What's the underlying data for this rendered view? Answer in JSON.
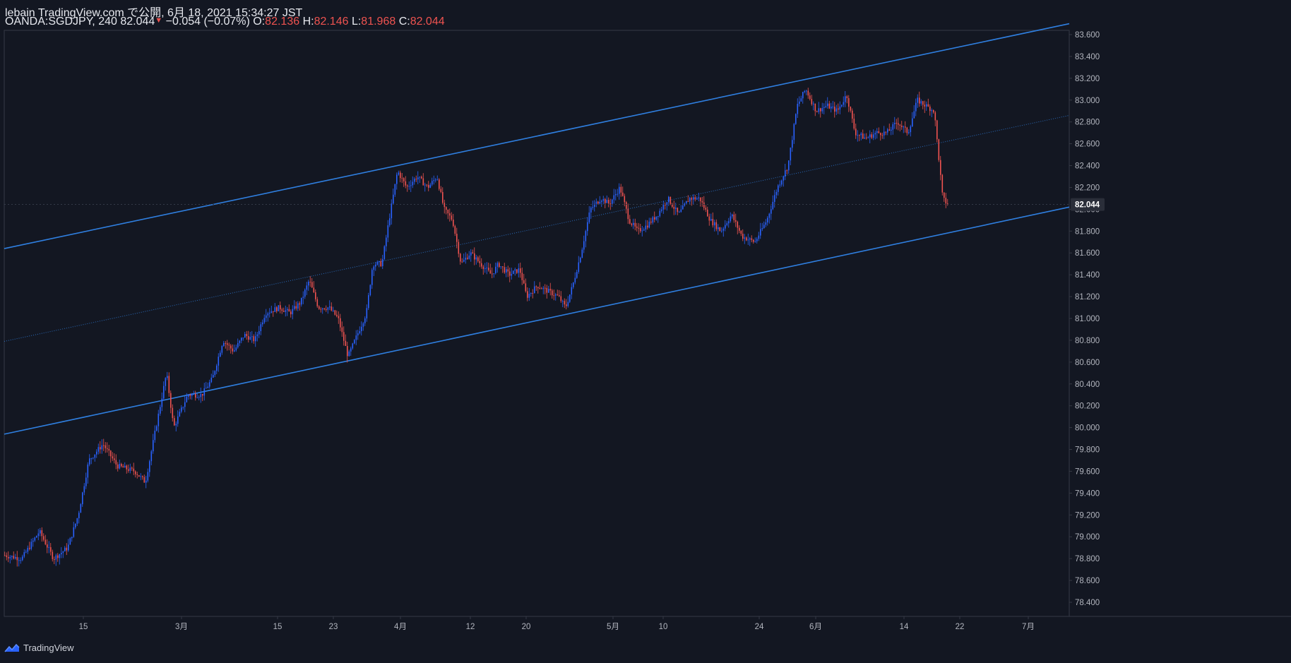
{
  "header": {
    "published_line": "lebain TradingView.com で公開, 6月 18, 2021 15:34:27 JST",
    "symbol": "OANDA:SGDJPY, 240",
    "last": "82.044",
    "change": "−0.054 (−0.07%)",
    "o_label": "O:",
    "o_value": "82.136",
    "h_label": "H:",
    "h_value": "82.146",
    "l_label": "L:",
    "l_value": "81.968",
    "c_label": "C:",
    "c_value": "82.044"
  },
  "footer": {
    "brand": "TradingView"
  },
  "colors": {
    "background": "#131722",
    "up": "#2962ff",
    "down": "#ef5350",
    "channel": "#2f7fe0",
    "axis_text": "#b2b5be",
    "frame": "#363a45"
  },
  "chart_data": {
    "type": "candlestick",
    "symbol": "OANDA:SGDJPY",
    "interval": "240",
    "ylim": [
      78.25,
      83.75
    ],
    "y_ticks": [
      "78.400",
      "78.600",
      "78.800",
      "79.000",
      "79.200",
      "79.400",
      "79.600",
      "79.800",
      "80.000",
      "80.200",
      "80.400",
      "80.600",
      "80.800",
      "81.000",
      "81.200",
      "81.400",
      "81.600",
      "81.800",
      "82.000",
      "82.200",
      "82.400",
      "82.600",
      "82.800",
      "83.000",
      "83.200",
      "83.400",
      "83.600"
    ],
    "x_ticks": [
      "15",
      "3月",
      "15",
      "23",
      "4月",
      "12",
      "20",
      "5月",
      "10",
      "24",
      "6月",
      "14",
      "22",
      "7月"
    ],
    "x_tick_positions": [
      118,
      257,
      393,
      472,
      567,
      666,
      745,
      868,
      939,
      1075,
      1155,
      1280,
      1359,
      1456
    ],
    "last_price_label": "82.044",
    "last_price": 82.044,
    "path_anchors": [
      [
        6,
        78.83
      ],
      [
        30,
        78.8
      ],
      [
        55,
        79.05
      ],
      [
        75,
        78.8
      ],
      [
        95,
        78.9
      ],
      [
        110,
        79.2
      ],
      [
        125,
        79.7
      ],
      [
        145,
        79.85
      ],
      [
        165,
        79.65
      ],
      [
        190,
        79.6
      ],
      [
        205,
        79.5
      ],
      [
        220,
        80.0
      ],
      [
        235,
        80.5
      ],
      [
        245,
        80.0
      ],
      [
        265,
        80.3
      ],
      [
        285,
        80.3
      ],
      [
        300,
        80.45
      ],
      [
        315,
        80.8
      ],
      [
        330,
        80.7
      ],
      [
        345,
        80.85
      ],
      [
        360,
        80.8
      ],
      [
        375,
        81.05
      ],
      [
        395,
        81.1
      ],
      [
        410,
        81.05
      ],
      [
        425,
        81.15
      ],
      [
        437,
        81.35
      ],
      [
        450,
        81.1
      ],
      [
        465,
        81.1
      ],
      [
        478,
        81.0
      ],
      [
        492,
        80.65
      ],
      [
        505,
        80.85
      ],
      [
        518,
        81.05
      ],
      [
        527,
        81.5
      ],
      [
        540,
        81.5
      ],
      [
        550,
        81.9
      ],
      [
        562,
        82.35
      ],
      [
        575,
        82.2
      ],
      [
        590,
        82.3
      ],
      [
        605,
        82.2
      ],
      [
        618,
        82.3
      ],
      [
        628,
        82.0
      ],
      [
        640,
        81.9
      ],
      [
        652,
        81.5
      ],
      [
        665,
        81.6
      ],
      [
        680,
        81.5
      ],
      [
        695,
        81.4
      ],
      [
        705,
        81.5
      ],
      [
        720,
        81.4
      ],
      [
        735,
        81.45
      ],
      [
        745,
        81.2
      ],
      [
        760,
        81.3
      ],
      [
        775,
        81.25
      ],
      [
        790,
        81.2
      ],
      [
        800,
        81.1
      ],
      [
        810,
        81.3
      ],
      [
        822,
        81.6
      ],
      [
        835,
        82.0
      ],
      [
        850,
        82.1
      ],
      [
        862,
        82.05
      ],
      [
        877,
        82.2
      ],
      [
        890,
        81.9
      ],
      [
        902,
        81.8
      ],
      [
        915,
        81.85
      ],
      [
        930,
        81.95
      ],
      [
        945,
        82.1
      ],
      [
        960,
        81.95
      ],
      [
        975,
        82.1
      ],
      [
        990,
        82.1
      ],
      [
        1005,
        81.9
      ],
      [
        1020,
        81.8
      ],
      [
        1035,
        81.95
      ],
      [
        1050,
        81.75
      ],
      [
        1068,
        81.7
      ],
      [
        1085,
        81.9
      ],
      [
        1100,
        82.2
      ],
      [
        1115,
        82.4
      ],
      [
        1128,
        82.95
      ],
      [
        1140,
        83.1
      ],
      [
        1155,
        82.9
      ],
      [
        1170,
        82.95
      ],
      [
        1185,
        82.9
      ],
      [
        1198,
        83.05
      ],
      [
        1210,
        82.7
      ],
      [
        1225,
        82.65
      ],
      [
        1240,
        82.7
      ],
      [
        1255,
        82.7
      ],
      [
        1270,
        82.8
      ],
      [
        1285,
        82.7
      ],
      [
        1298,
        83.0
      ],
      [
        1310,
        82.95
      ],
      [
        1322,
        82.9
      ],
      [
        1328,
        82.5
      ],
      [
        1334,
        82.1
      ],
      [
        1341,
        82.044
      ]
    ],
    "channel_upper": [
      [
        6,
        81.64
      ],
      [
        1514,
        83.7
      ]
    ],
    "channel_middle": [
      [
        6,
        80.79
      ],
      [
        1514,
        82.86
      ]
    ],
    "channel_lower": [
      [
        6,
        79.94
      ],
      [
        1514,
        82.02
      ]
    ]
  }
}
